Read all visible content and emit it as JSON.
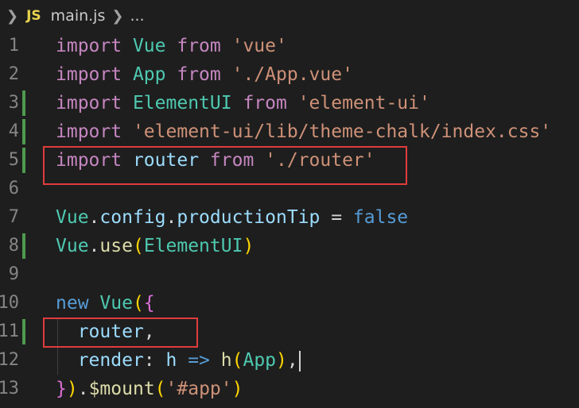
{
  "breadcrumb": {
    "file_badge": "JS",
    "file_name": "main.js",
    "more": "..."
  },
  "lines": [
    {
      "n": "1",
      "t1": "import",
      "t2": "Vue",
      "t3": "from",
      "t4": "'vue'"
    },
    {
      "n": "2",
      "t1": "import",
      "t2": "App",
      "t3": "from",
      "t4": "'./App.vue'"
    },
    {
      "n": "3",
      "t1": "import",
      "t2": "ElementUI",
      "t3": "from",
      "t4": "'element-ui'"
    },
    {
      "n": "4",
      "t1": "import",
      "t4": "'element-ui/lib/theme-chalk/index.css'"
    },
    {
      "n": "5",
      "t1": "import",
      "t2": "router",
      "t3": "from",
      "t4": "'./router'"
    },
    {
      "n": "6"
    },
    {
      "n": "7",
      "t1": "Vue",
      "t2": ".",
      "t3": "config",
      "t4": ".",
      "t5": "productionTip",
      "t6": " = ",
      "t7": "false"
    },
    {
      "n": "8",
      "t1": "Vue",
      "t2": ".",
      "t3": "use",
      "t4": "(",
      "t5": "ElementUI",
      "t6": ")"
    },
    {
      "n": "9"
    },
    {
      "n": "10",
      "t1": "new",
      "t2": "Vue",
      "t3": "(",
      "t4": "{"
    },
    {
      "n": "11",
      "t1": "router",
      "t2": ","
    },
    {
      "n": "12",
      "t1": "render",
      "t2": ": ",
      "t3": "h",
      "t4": " => ",
      "t5": "h",
      "t6": "(",
      "t7": "App",
      "t8": ")",
      "t9": ","
    },
    {
      "n": "13",
      "t1": "}",
      "t2": ")",
      "t3": ".",
      "t4": "$mount",
      "t5": "(",
      "t6": "'#app'",
      "t7": ")"
    }
  ],
  "colors": {
    "keyword": "#c586c0",
    "class_name": "#4ec9b0",
    "variable": "#9cdcfe",
    "string": "#ce9178",
    "function": "#dcdcaa",
    "boolean": "#569cd6",
    "highlight_border": "#e03c3c",
    "gutter_added": "#4e9a4e"
  }
}
